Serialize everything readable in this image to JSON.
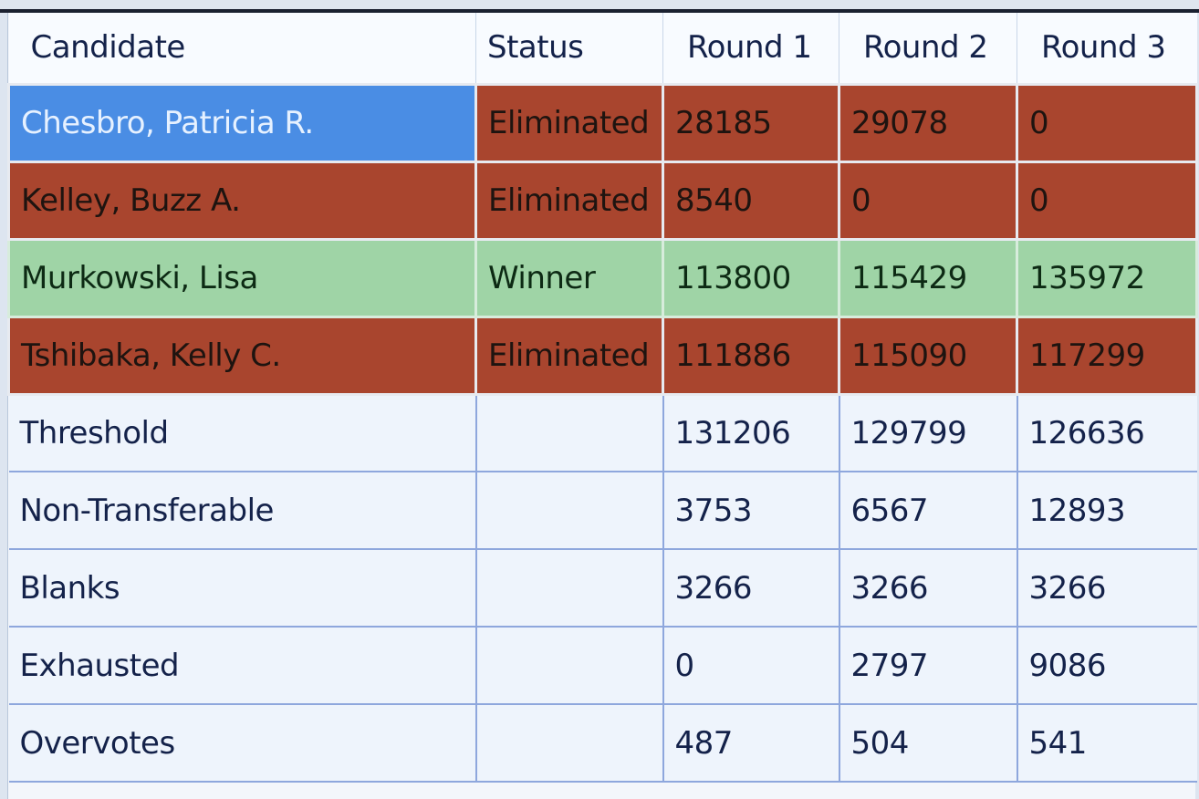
{
  "table": {
    "columns": [
      "Candidate",
      "Status",
      "Round 1",
      "Round 2",
      "Round 3"
    ],
    "candidates": [
      {
        "name": "Chesbro, Patricia R.",
        "status": "Eliminated",
        "rounds": [
          "28185",
          "29078",
          "0"
        ],
        "selected": true
      },
      {
        "name": "Kelley, Buzz A.",
        "status": "Eliminated",
        "rounds": [
          "8540",
          "0",
          "0"
        ],
        "selected": false
      },
      {
        "name": "Murkowski, Lisa",
        "status": "Winner",
        "rounds": [
          "113800",
          "115429",
          "135972"
        ],
        "selected": false
      },
      {
        "name": "Tshibaka, Kelly C.",
        "status": "Eliminated",
        "rounds": [
          "111886",
          "115090",
          "117299"
        ],
        "selected": false
      }
    ],
    "summary": [
      {
        "label": "Threshold",
        "rounds": [
          "131206",
          "129799",
          "126636"
        ]
      },
      {
        "label": "Non-Transferable",
        "rounds": [
          "3753",
          "6567",
          "12893"
        ]
      },
      {
        "label": "Blanks",
        "rounds": [
          "3266",
          "3266",
          "3266"
        ]
      },
      {
        "label": "Exhausted",
        "rounds": [
          "0",
          "2797",
          "9086"
        ]
      },
      {
        "label": "Overvotes",
        "rounds": [
          "487",
          "504",
          "541"
        ]
      }
    ]
  },
  "colors": {
    "eliminated": "#a9452e",
    "winner": "#9fd4a6",
    "selected": "#4a8de4"
  }
}
